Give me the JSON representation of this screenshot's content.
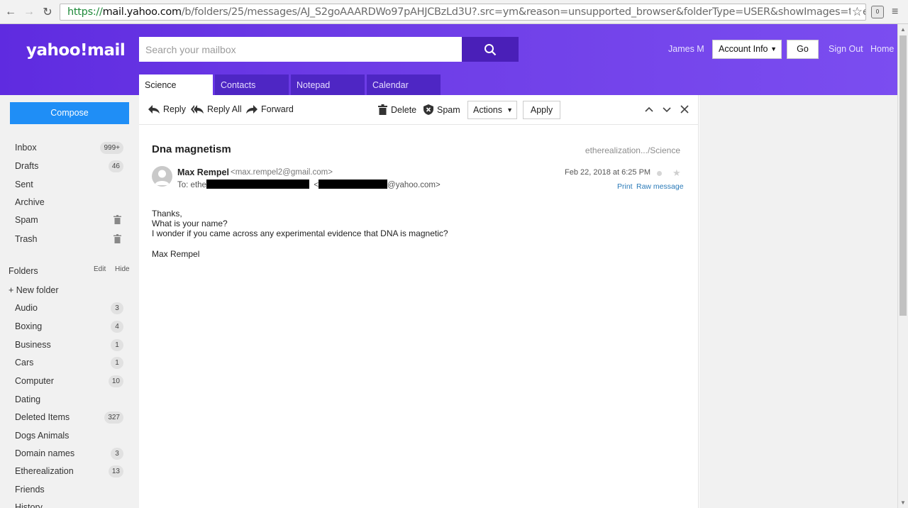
{
  "browser": {
    "url_scheme": "https://",
    "url_host": "mail.yahoo.com",
    "url_rest": "/b/folders/25/messages/AJ_S2goAAARDWo97pAHJCBzLd3U?.src=ym&reason=unsupported_browser&folderType=USER&showImages=true&offset=",
    "ext_badge": "0"
  },
  "header": {
    "logo": "yahoo!mail",
    "search_placeholder": "Search your mailbox",
    "user_name": "James M",
    "account_select": "Account Info",
    "go_label": "Go",
    "sign_out": "Sign Out",
    "home": "Home"
  },
  "tabs": [
    {
      "label": "Science",
      "active": true
    },
    {
      "label": "Contacts",
      "active": false
    },
    {
      "label": "Notepad",
      "active": false
    },
    {
      "label": "Calendar",
      "active": false
    }
  ],
  "sidebar": {
    "compose": "Compose",
    "system_items": [
      {
        "label": "Inbox",
        "count": "999+"
      },
      {
        "label": "Drafts",
        "count": "46"
      },
      {
        "label": "Sent",
        "count": ""
      },
      {
        "label": "Archive",
        "count": ""
      },
      {
        "label": "Spam",
        "count": "",
        "trash": true
      },
      {
        "label": "Trash",
        "count": "",
        "trash": true
      }
    ],
    "folders_label": "Folders",
    "edit_label": "Edit",
    "hide_label": "Hide",
    "new_folder": "+ New folder",
    "folders": [
      {
        "label": "Audio",
        "count": "3"
      },
      {
        "label": "Boxing",
        "count": "4"
      },
      {
        "label": "Business",
        "count": "1"
      },
      {
        "label": "Cars",
        "count": "1"
      },
      {
        "label": "Computer",
        "count": "10"
      },
      {
        "label": "Dating",
        "count": ""
      },
      {
        "label": "Deleted Items",
        "count": "327"
      },
      {
        "label": "Dogs Animals",
        "count": ""
      },
      {
        "label": "Domain names",
        "count": "3"
      },
      {
        "label": "Etherealization",
        "count": "13"
      },
      {
        "label": "Friends",
        "count": ""
      },
      {
        "label": "History",
        "count": ""
      }
    ]
  },
  "toolbar": {
    "reply": "Reply",
    "reply_all": "Reply All",
    "forward": "Forward",
    "delete": "Delete",
    "spam": "Spam",
    "actions": "Actions",
    "apply": "Apply"
  },
  "message": {
    "subject": "Dna magnetism",
    "folder_path": "etherealization.../Science",
    "from_name": "Max Rempel",
    "from_email": "<max.rempel2@gmail.com>",
    "to_prefix": "To:",
    "to_start": "ethe",
    "to_lt": "<",
    "to_domain": "@yahoo.com>",
    "date": "Feb 22, 2018 at 6:25 PM",
    "print": "Print",
    "raw": "Raw message",
    "body": [
      "Thanks,",
      "What is your name?",
      "I wonder if you came across any experimental evidence that DNA is magnetic?",
      "",
      "Max Rempel"
    ]
  }
}
